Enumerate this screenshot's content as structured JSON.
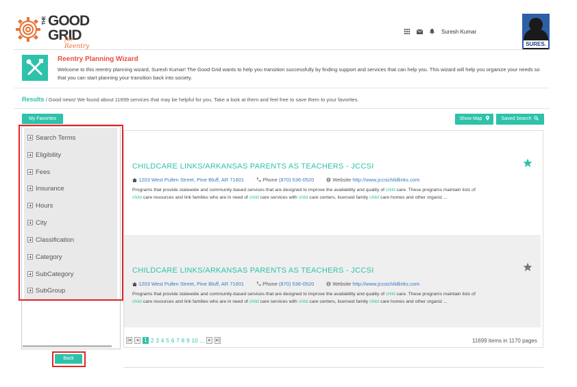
{
  "brand": {
    "the": "THE",
    "good": "GOOD",
    "grid": "GRID",
    "tagline": "for Reentry"
  },
  "header": {
    "user_name": "Suresh Kumar",
    "avatar_tag": "SURES."
  },
  "wizard": {
    "title": "Reentry Planning Wizard",
    "text": "Welcome to this reentry planning wizard, Suresh Kumar! The Good Grid wants to help you transition successfully by finding support and services that can help you. This wizard will help you organize your needs so that you can start planning your transition back into society."
  },
  "results": {
    "label": "Results",
    "message": " / Good news! We found about 11699 services that may be helpful for you. Take a look at them and feel free to save them to your favorites."
  },
  "buttons": {
    "favorites": "My Favorites",
    "show_map": "Show Map",
    "saved_search": "Saved Search",
    "back": "Back"
  },
  "filters": [
    "Search Terms",
    "Eligibility",
    "Fees",
    "Insurance",
    "Hours",
    "City",
    "Classification",
    "Category",
    "SubCategory",
    "SubGroup"
  ],
  "cards": [
    {
      "title": "CHILDCARE LINKS/ARKANSAS PARENTS AS TEACHERS - JCCSI",
      "address": "1203 West Pullen Street,  Pine Bluff,  AR 71601",
      "phone_label": "Phone",
      "phone": "(870) 536-0520",
      "website_label": "Website",
      "website": "http://www.jccsichildlinks.com",
      "favorited": true
    },
    {
      "title": "CHILDCARE LINKS/ARKANSAS PARENTS AS TEACHERS - JCCSI",
      "address": "1203 West Pullen Street,  Pine Bluff,  AR 71601",
      "phone_label": "Phone",
      "phone": "(870) 536-0520",
      "website_label": "Website",
      "website": "http://www.jccsichildlinks.com",
      "favorited": false
    }
  ],
  "desc": {
    "p1": "Programs that provide statewide and community-based services that are designed to improve the availability and quality of ",
    "p2": " care. These programs maintain lists of",
    "p3": " care resources and link families who are in need of ",
    "p4": " care services with ",
    "p5": " care centers, licensed family ",
    "p6": " care homes and other organiz ...",
    "hl": "child"
  },
  "pager": {
    "pages": [
      "1",
      "2",
      "3",
      "4",
      "5",
      "6",
      "7",
      "8",
      "9",
      "10",
      "..."
    ],
    "current": "1",
    "summary": "11699 items in 1170 pages"
  },
  "colors": {
    "accent": "#2dc2a9",
    "alert": "#e4503f",
    "highlight_box": "#e02424",
    "link": "#3a78c2"
  }
}
